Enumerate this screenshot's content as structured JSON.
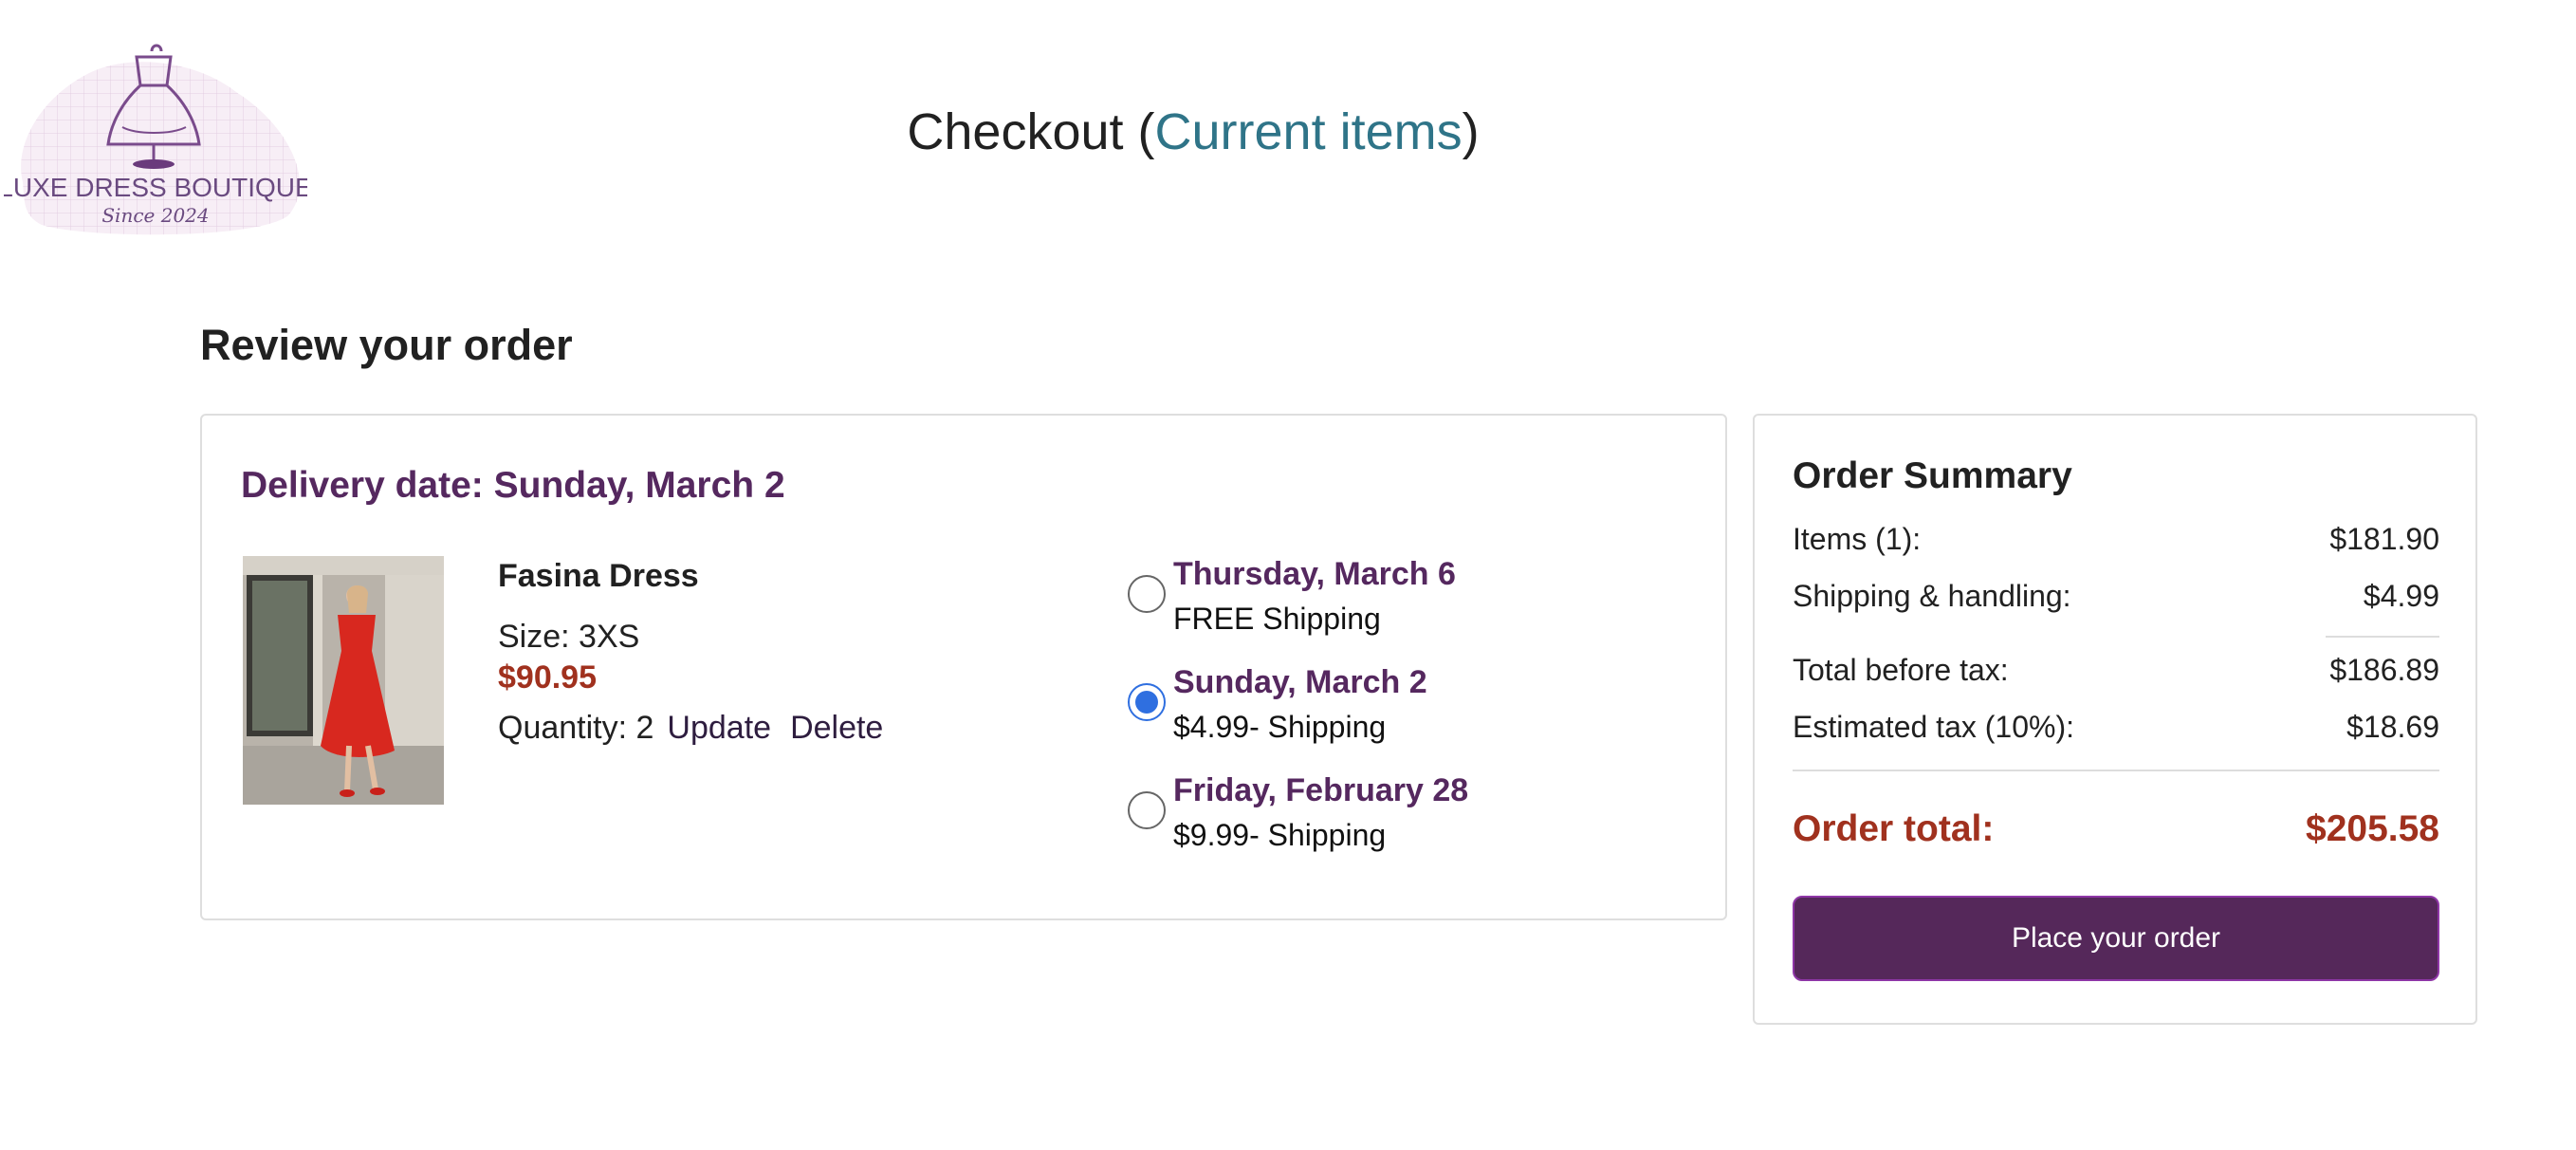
{
  "brand": {
    "logo_text": "LUXE DRESS BOUTIQUE",
    "logo_tagline": "Since 2024",
    "logo_icon": "dress-form-icon"
  },
  "header": {
    "title_prefix": "Checkout (",
    "current_items_link": "Current items",
    "title_suffix": ")"
  },
  "review": {
    "heading": "Review your order",
    "delivery_label": "Delivery date: Sunday, March 2",
    "product": {
      "name": "Fasina Dress",
      "size": "Size: 3XS",
      "price": "$90.95",
      "quantity": "Quantity: 2",
      "update_label": "Update",
      "delete_label": "Delete"
    },
    "shipping_options": [
      {
        "date": "Thursday, March 6",
        "price": "FREE Shipping",
        "selected": false
      },
      {
        "date": "Sunday, March 2",
        "price": "$4.99- Shipping",
        "selected": true
      },
      {
        "date": "Friday, February 28",
        "price": "$9.99- Shipping",
        "selected": false
      }
    ]
  },
  "summary": {
    "title": "Order Summary",
    "items_label": "Items (1):",
    "items_value": "$181.90",
    "shipping_label": "Shipping & handling:",
    "shipping_value": "$4.99",
    "before_tax_label": "Total before tax:",
    "before_tax_value": "$186.89",
    "tax_label": "Estimated tax (10%):",
    "tax_value": "$18.69",
    "total_label": "Order total:",
    "total_value": "$205.58",
    "place_order_label": "Place your order"
  },
  "colors": {
    "accent_purple": "#55285f",
    "link_teal": "#2f7488",
    "price_red": "#a0311e",
    "radio_blue": "#2f6fe0",
    "button_bg": "#55285a"
  }
}
